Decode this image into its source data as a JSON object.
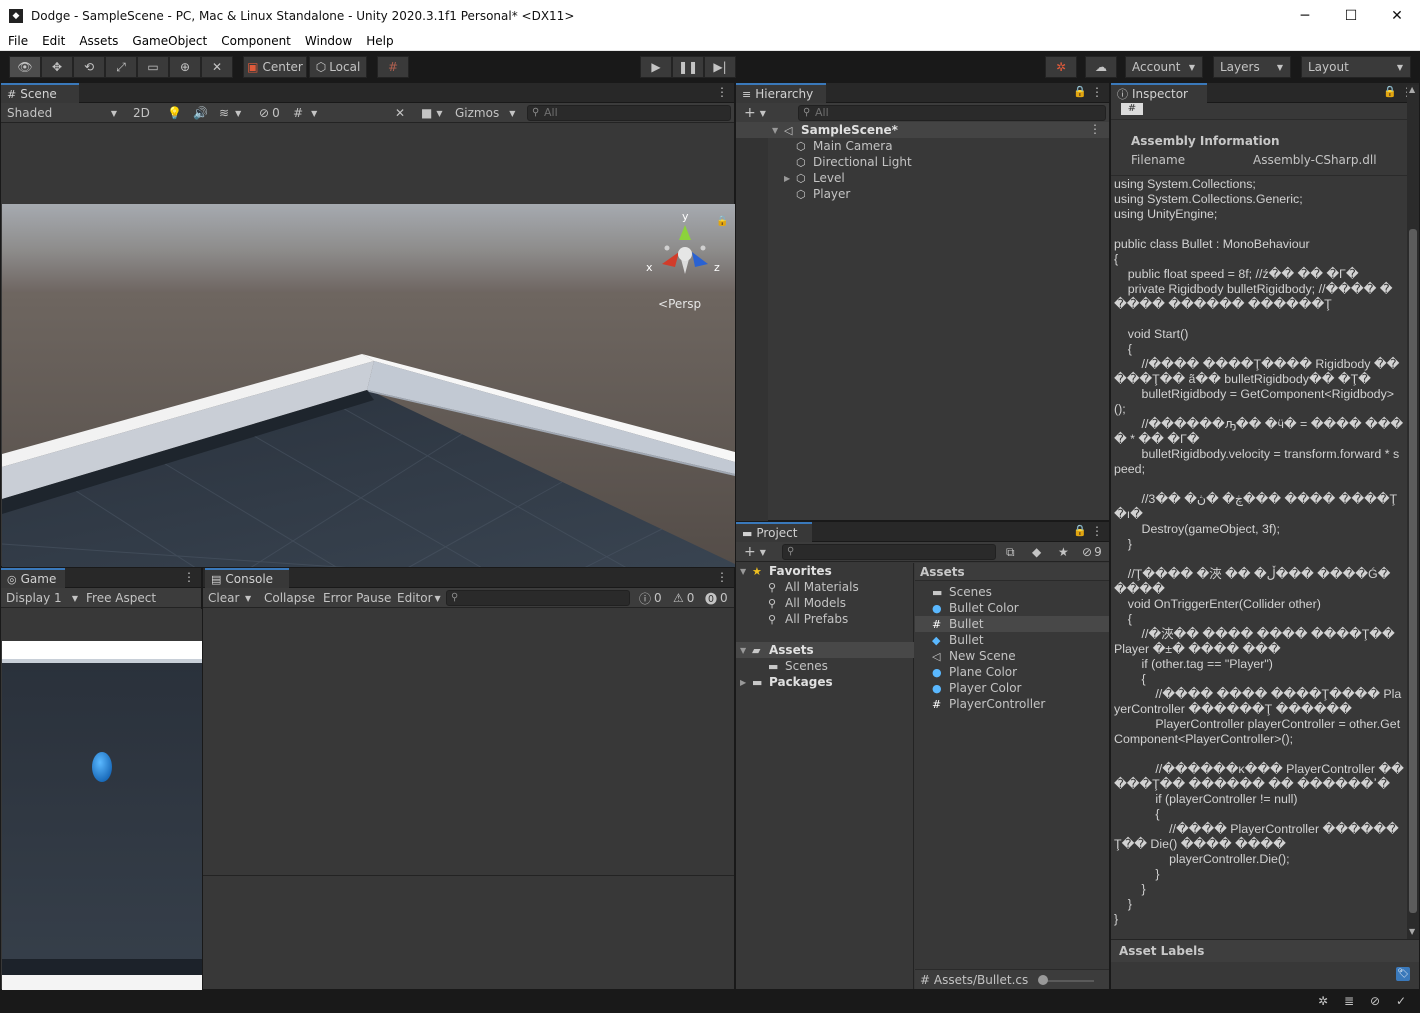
{
  "window": {
    "title": "Dodge - SampleScene - PC, Mac & Linux Standalone - Unity 2020.3.1f1 Personal* <DX11>",
    "app_icon": "unity-icon",
    "controls": {
      "minimize": "─",
      "maximize": "☐",
      "close": "✕"
    }
  },
  "menu": [
    "File",
    "Edit",
    "Assets",
    "GameObject",
    "Component",
    "Window",
    "Help"
  ],
  "toolbar": {
    "pivot_label": "Center",
    "space_label": "Local",
    "account_label": "Account",
    "layers_label": "Layers",
    "layout_label": "Layout"
  },
  "scene": {
    "tab_label": "Scene",
    "shading_mode": "Shaded",
    "mode_2d": "2D",
    "hidden_count": "0",
    "gizmos_label": "Gizmos",
    "search_placeholder": "All",
    "persp_label": "Persp",
    "axis_x": "x",
    "axis_y": "y",
    "axis_z": "z"
  },
  "hierarchy": {
    "tab_label": "Hierarchy",
    "search_placeholder": "All",
    "scene_name": "SampleScene*",
    "items": [
      "Main Camera",
      "Directional Light",
      "Level",
      "Player"
    ]
  },
  "inspector": {
    "tab_label": "Inspector",
    "section_title": "Assembly Information",
    "filename_label": "Filename",
    "filename_value": "Assembly-CSharp.dll",
    "asset_labels": "Asset Labels",
    "code_lines": [
      "using System.Collections;",
      "using System.Collections.Generic;",
      "using UnityEngine;",
      "",
      "public class Bullet : MonoBehaviour",
      "{",
      "    public float speed = 8f; //ź�� �� �Γ�",
      "    private Rigidbody bulletRigidbody; //���� ����� ������ ������Ţ",
      "",
      "    void Start()",
      "    {",
      "        //���� ����Ţ���� Rigidbody �����Ţ�� ã�� bulletRigidbody�� �Ţ�",
      "        bulletRigidbody = GetComponent<Rigidbody>();",
      "        //������ԡ�� �ӵ� = ���� ���� * �� �Γ�",
      "        bulletRigidbody.velocity = transform.forward * speed;",
      "",
      "        //3�� �ڿ� �ڽ��� ���� ����Ţ �ı�",
      "        Destroy(gameObject, 3f);",
      "    }",
      "",
      "    //Ţ���� �浹 �� �ڵ��� ����Ǵ� ����",
      "    void OnTriggerEnter(Collider other)",
      "    {",
      "        //�浹�� ���� ���� ����Ţ�� Player �±� ���� ���",
      "        if (other.tag == \"Player\")",
      "        {",
      "            //���� ���� ����Ţ���� PlayerController ������Ţ ������",
      "            PlayerController playerController = other.GetComponent<PlayerController>();",
      "",
      "            //������κ��� PlayerController �����Ţ�� ������ �� ������ߴ�",
      "            if (playerController != null)",
      "            {",
      "                //���� PlayerController ������Ţ�� Die() ���� ����",
      "                playerController.Die();",
      "            }",
      "        }",
      "    }",
      "}"
    ]
  },
  "game": {
    "tab_label": "Game",
    "display_label": "Display 1",
    "aspect_label": "Free Aspect"
  },
  "console": {
    "tab_label": "Console",
    "clear_label": "Clear",
    "collapse_label": "Collapse",
    "error_pause_label": "Error Pause",
    "editor_label": "Editor",
    "error_count": "0",
    "warning_count": "0",
    "info_count": "0"
  },
  "project": {
    "tab_label": "Project",
    "hidden_count": "9",
    "favorites_label": "Favorites",
    "favorites": [
      "All Materials",
      "All Models",
      "All Prefabs"
    ],
    "assets_label": "Assets",
    "assets_children": [
      "Scenes"
    ],
    "packages_label": "Packages",
    "assets_header": "Assets",
    "asset_items": [
      {
        "name": "Scenes",
        "icon": "folder-icon"
      },
      {
        "name": "Bullet Color",
        "icon": "material-icon"
      },
      {
        "name": "Bullet",
        "icon": "script-icon"
      },
      {
        "name": "Bullet",
        "icon": "prefab-icon"
      },
      {
        "name": "New Scene",
        "icon": "scene-icon"
      },
      {
        "name": "Plane Color",
        "icon": "material-icon"
      },
      {
        "name": "Player Color",
        "icon": "material-icon"
      },
      {
        "name": "PlayerController",
        "icon": "script-icon"
      }
    ],
    "selected_path": "Assets/Bullet.cs"
  },
  "colors": {
    "accent": "#3a79bb",
    "panel_bg": "#383838",
    "dark_bg": "#191919",
    "selection": "#4d4d4d",
    "player_capsule": "#1e88d8"
  }
}
